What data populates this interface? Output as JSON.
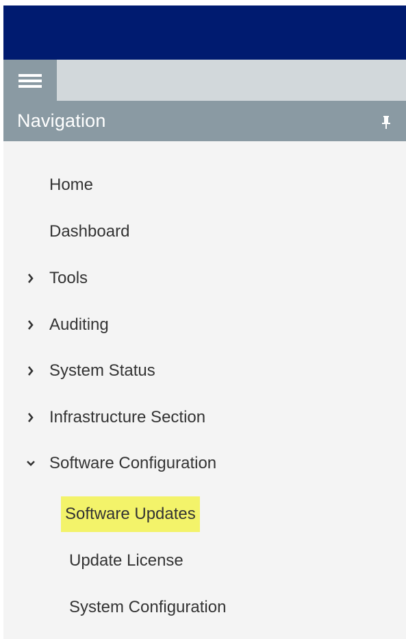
{
  "navigation": {
    "title": "Navigation",
    "menu_icon": "hamburger-menu-icon",
    "pin_icon": "pin-icon",
    "items": [
      {
        "label": "Home",
        "expandable": false
      },
      {
        "label": "Dashboard",
        "expandable": false
      },
      {
        "label": "Tools",
        "expandable": true,
        "expanded": false
      },
      {
        "label": "Auditing",
        "expandable": true,
        "expanded": false
      },
      {
        "label": "System Status",
        "expandable": true,
        "expanded": false
      },
      {
        "label": "Infrastructure Section",
        "expandable": true,
        "expanded": false
      },
      {
        "label": "Software Configuration",
        "expandable": true,
        "expanded": true
      }
    ],
    "subitems": [
      {
        "label": "Software Updates",
        "highlighted": true
      },
      {
        "label": "Update License",
        "highlighted": false
      },
      {
        "label": "System Configuration",
        "highlighted": false
      }
    ]
  },
  "colors": {
    "topbar": "#001b70",
    "toolbar": "#d2d8db",
    "nav_header": "#8a9aa3",
    "panel_bg": "#f4f4f4",
    "highlight": "#f3f36a",
    "text": "#333333"
  }
}
